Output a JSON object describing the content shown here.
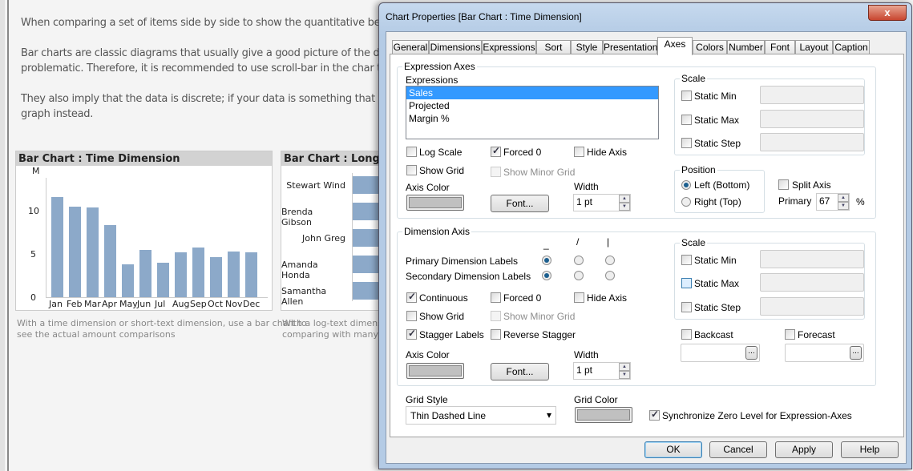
{
  "page": {
    "intro_lines": [
      "When comparing a set of items side by side to show the quantitative beha",
      "Bar charts are classic diagrams that usually give a good picture of the data.",
      "problematic. Therefore, it is recommended to use scroll-bar in the char to",
      "They also imply that the data is discrete; if your data is something that is p",
      "graph instead."
    ],
    "chart1": {
      "title": "Bar Chart : Time Dimension",
      "caption_lines": [
        "With a time dimension or short-text dimension, use a bar chart to",
        "see the actual amount comparisons"
      ]
    },
    "chart2": {
      "title": "Bar Chart : Long-te",
      "names": [
        "Stewart Wind",
        "Brenda Gibson",
        "John Greg",
        "Amanda Honda",
        "Samantha Allen"
      ],
      "caption_lines": [
        "With a log-text dimension,",
        "comparing with many item"
      ]
    }
  },
  "chart_data": {
    "type": "bar",
    "title": "Bar Chart : Time Dimension",
    "ylabel": "M",
    "categories": [
      "Jan",
      "Feb",
      "Mar",
      "Apr",
      "May",
      "Jun",
      "Jul",
      "Aug",
      "Sep",
      "Oct",
      "Nov",
      "Dec"
    ],
    "values": [
      11.6,
      10.5,
      10.4,
      8.3,
      3.8,
      5.5,
      4.0,
      5.2,
      5.7,
      4.6,
      5.3,
      5.2
    ],
    "yticks": [
      "0",
      "5",
      "10"
    ],
    "ylim": [
      0,
      14
    ],
    "color": "#8ca9c9"
  },
  "dialog": {
    "title": "Chart Properties [Bar Chart : Time Dimension]",
    "close": "x",
    "tabs": [
      "General",
      "Dimensions",
      "Expressions",
      "Sort",
      "Style",
      "Presentation",
      "Axes",
      "Colors",
      "Number",
      "Font",
      "Layout",
      "Caption"
    ],
    "expr": {
      "group": "Expression Axes",
      "list_label": "Expressions",
      "items": [
        "Sales",
        "Projected",
        "Margin %"
      ],
      "log_scale": "Log Scale",
      "forced0": "Forced 0",
      "hide_axis": "Hide Axis",
      "show_grid": "Show Grid",
      "show_minor_grid": "Show Minor Grid",
      "axis_color": "Axis Color",
      "font": "Font...",
      "width_label": "Width",
      "width_value": "1 pt",
      "scale": "Scale",
      "static_min": "Static Min",
      "static_max": "Static Max",
      "static_step": "Static Step",
      "position": "Position",
      "left_bottom": "Left (Bottom)",
      "right_top": "Right (Top)",
      "split_axis": "Split Axis",
      "primary": "Primary",
      "primary_value": "67",
      "percent": "%"
    },
    "dim": {
      "group": "Dimension Axis",
      "orient": [
        "_",
        "/",
        "|"
      ],
      "primary_labels": "Primary Dimension Labels",
      "secondary_labels": "Secondary Dimension Labels",
      "continuous": "Continuous",
      "forced0": "Forced 0",
      "hide_axis": "Hide Axis",
      "show_grid": "Show Grid",
      "show_minor_grid": "Show Minor Grid",
      "stagger": "Stagger Labels",
      "reverse_stagger": "Reverse Stagger",
      "axis_color": "Axis Color",
      "font": "Font...",
      "width_label": "Width",
      "width_value": "1 pt",
      "scale": "Scale",
      "static_min": "Static Min",
      "static_max": "Static Max",
      "static_step": "Static Step",
      "backcast": "Backcast",
      "forecast": "Forecast",
      "ellipsis": "..."
    },
    "grid_style_label": "Grid Style",
    "grid_style_value": "Thin Dashed Line",
    "grid_color_label": "Grid Color",
    "sync_zero": "Synchronize Zero Level for Expression-Axes",
    "buttons": {
      "ok": "OK",
      "cancel": "Cancel",
      "apply": "Apply",
      "help": "Help"
    }
  }
}
